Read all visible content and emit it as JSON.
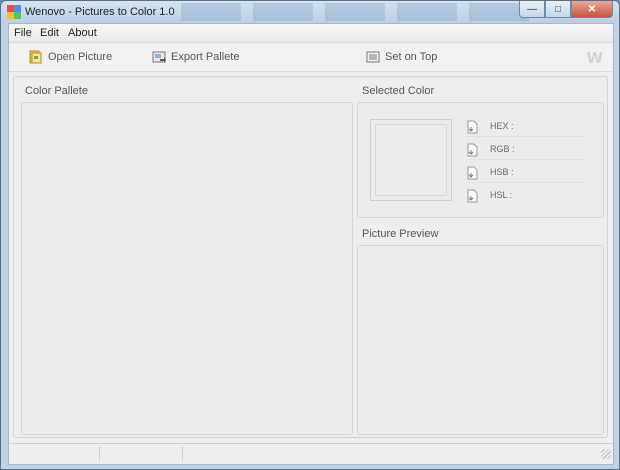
{
  "window": {
    "title": "Wenovo - Pictures to Color 1.0"
  },
  "menu": {
    "items": [
      "File",
      "Edit",
      "About"
    ]
  },
  "toolbar": {
    "open_label": "Open Picture",
    "export_label": "Export Pallete",
    "settop_label": "Set on Top",
    "logo_text": "W"
  },
  "sections": {
    "palette_title": "Color Pallete",
    "selected_title": "Selected Color",
    "preview_title": "Picture Preview"
  },
  "color_fields": [
    {
      "label": "HEX :"
    },
    {
      "label": "RGB :"
    },
    {
      "label": "HSB :"
    },
    {
      "label": "HSL :"
    }
  ],
  "colors": {
    "titlebar": "#c9dcee",
    "panel_bg": "#efefef",
    "border": "#d6d6d6",
    "text": "#555555"
  }
}
